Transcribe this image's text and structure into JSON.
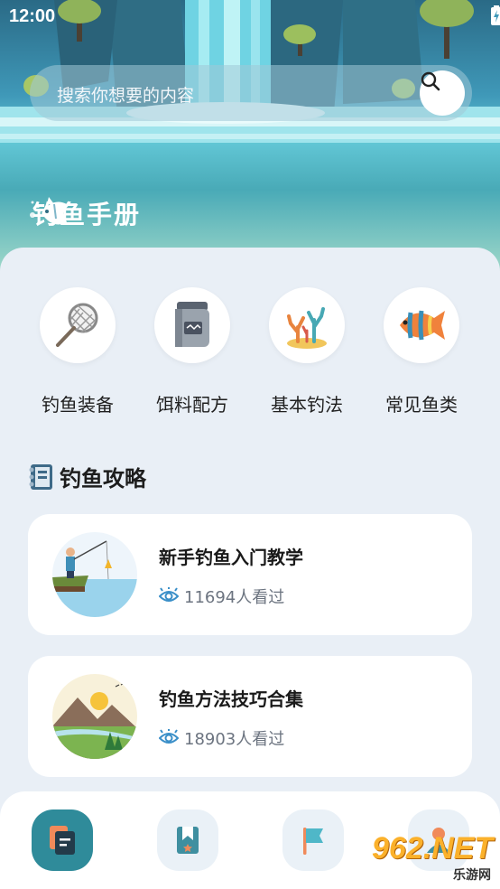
{
  "status_bar": {
    "time": "12:00"
  },
  "search": {
    "placeholder": "搜索你想要的内容"
  },
  "header": {
    "title": "钓鱼手册"
  },
  "categories": [
    {
      "label": "钓鱼装备",
      "icon": "fishing-net-icon"
    },
    {
      "label": "饵料配方",
      "icon": "bait-jar-icon"
    },
    {
      "label": "基本钓法",
      "icon": "coral-icon"
    },
    {
      "label": "常见鱼类",
      "icon": "tropical-fish-icon"
    }
  ],
  "guides": {
    "title": "钓鱼攻略",
    "items": [
      {
        "title": "新手钓鱼入门教学",
        "views": "11694人看过"
      },
      {
        "title": "钓鱼方法技巧合集",
        "views": "18903人看过"
      }
    ]
  },
  "bottom_nav": [
    {
      "icon": "document-icon",
      "active": true
    },
    {
      "icon": "bookmark-icon",
      "active": false
    },
    {
      "icon": "flag-icon",
      "active": false
    },
    {
      "icon": "user-icon",
      "active": false
    }
  ],
  "watermark": {
    "brand": "962.NET",
    "sub": "乐游网"
  },
  "colors": {
    "accent": "#2f8b9a",
    "background": "#e9eff6"
  }
}
